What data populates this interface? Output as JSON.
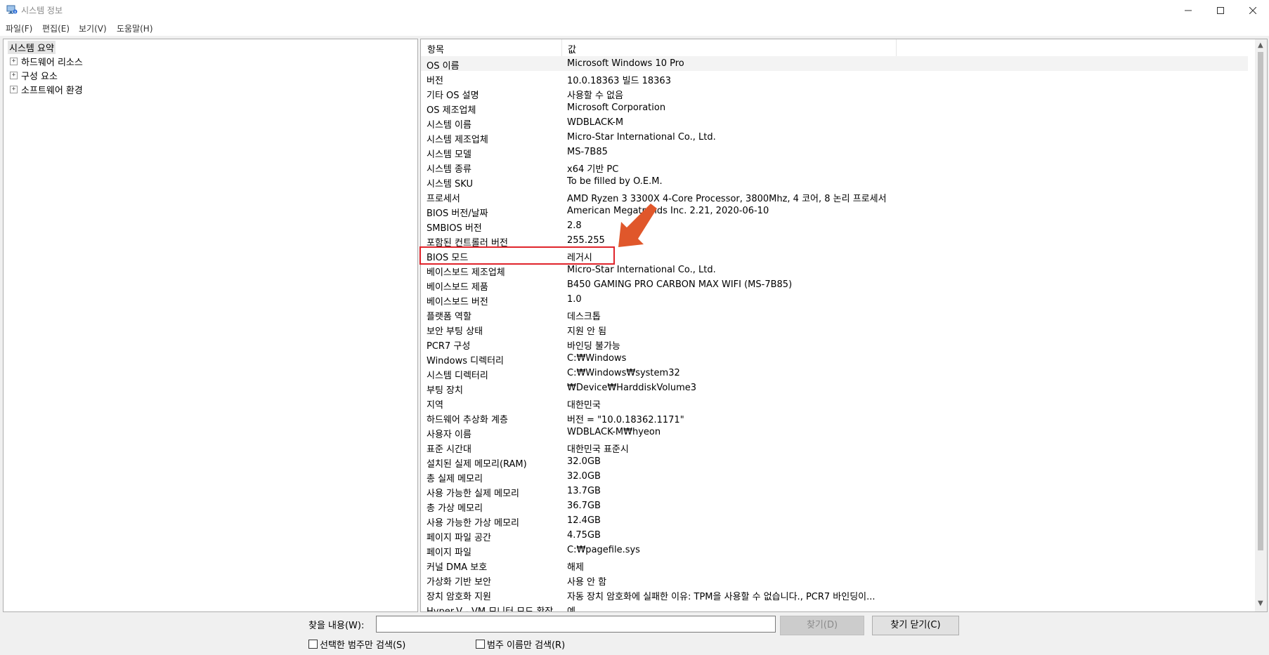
{
  "window": {
    "title": "시스템 정보"
  },
  "menu": [
    {
      "label": "파일(F)"
    },
    {
      "label": "편집(E)"
    },
    {
      "label": "보기(V)"
    },
    {
      "label": "도움말(H)"
    }
  ],
  "tree": {
    "root": "시스템 요약",
    "children": [
      {
        "label": "하드웨어 리소스"
      },
      {
        "label": "구성 요소"
      },
      {
        "label": "소프트웨어 환경"
      }
    ]
  },
  "table": {
    "columns": [
      "항목",
      "값"
    ],
    "rows": [
      {
        "k": "OS 이름",
        "v": "Microsoft Windows 10 Pro"
      },
      {
        "k": "버전",
        "v": "10.0.18363 빌드 18363"
      },
      {
        "k": "기타 OS 설명",
        "v": "사용할 수 없음"
      },
      {
        "k": "OS 제조업체",
        "v": "Microsoft Corporation"
      },
      {
        "k": "시스템 이름",
        "v": "WDBLACK-M"
      },
      {
        "k": "시스템 제조업체",
        "v": "Micro-Star International Co., Ltd."
      },
      {
        "k": "시스템 모델",
        "v": "MS-7B85"
      },
      {
        "k": "시스템 종류",
        "v": "x64 기반 PC"
      },
      {
        "k": "시스템 SKU",
        "v": "To be filled by O.E.M."
      },
      {
        "k": "프로세서",
        "v": "AMD Ryzen 3 3300X 4-Core Processor, 3800Mhz, 4 코어, 8 논리 프로세서"
      },
      {
        "k": "BIOS 버전/날짜",
        "v": "American Megatrends Inc. 2.21, 2020-06-10"
      },
      {
        "k": "SMBIOS 버전",
        "v": "2.8"
      },
      {
        "k": "포함된 컨트롤러 버전",
        "v": "255.255"
      },
      {
        "k": "BIOS 모드",
        "v": "레거시"
      },
      {
        "k": "베이스보드 제조업체",
        "v": "Micro-Star International Co., Ltd."
      },
      {
        "k": "베이스보드 제품",
        "v": "B450 GAMING PRO CARBON MAX WIFI (MS-7B85)"
      },
      {
        "k": "베이스보드 버전",
        "v": "1.0"
      },
      {
        "k": "플랫폼 역할",
        "v": "데스크톱"
      },
      {
        "k": "보안 부팅 상태",
        "v": "지원 안 됨"
      },
      {
        "k": "PCR7 구성",
        "v": "바인딩 불가능"
      },
      {
        "k": "Windows 디렉터리",
        "v": "C:₩Windows"
      },
      {
        "k": "시스템 디렉터리",
        "v": "C:₩Windows₩system32"
      },
      {
        "k": "부팅 장치",
        "v": "₩Device₩HarddiskVolume3"
      },
      {
        "k": "지역",
        "v": "대한민국"
      },
      {
        "k": "하드웨어 추상화 계층",
        "v": "버전 = \"10.0.18362.1171\""
      },
      {
        "k": "사용자 이름",
        "v": "WDBLACK-M₩hyeon"
      },
      {
        "k": "표준 시간대",
        "v": "대한민국 표준시"
      },
      {
        "k": "설치된 실제 메모리(RAM)",
        "v": "32.0GB"
      },
      {
        "k": "총 실제 메모리",
        "v": "32.0GB"
      },
      {
        "k": "사용 가능한 실제 메모리",
        "v": "13.7GB"
      },
      {
        "k": "총 가상 메모리",
        "v": "36.7GB"
      },
      {
        "k": "사용 가능한 가상 메모리",
        "v": "12.4GB"
      },
      {
        "k": "페이지 파일 공간",
        "v": "4.75GB"
      },
      {
        "k": "페이지 파일",
        "v": "C:₩pagefile.sys"
      },
      {
        "k": "커널 DMA 보호",
        "v": "해제"
      },
      {
        "k": "가상화 기반 보안",
        "v": "사용 안 함"
      },
      {
        "k": "장치 암호화 지원",
        "v": "자동 장치 암호화에 실패한 이유: TPM을 사용할 수 없습니다., PCR7 바인딩이..."
      },
      {
        "k": "Hyper-V - VM 모니터 모드 확장",
        "v": "예"
      }
    ]
  },
  "find": {
    "label": "찾을 내용(W):",
    "value": "",
    "find_button": "찾기(D)",
    "close_button": "찾기 닫기(C)",
    "scope_selected": "선택한 범주만 검색(S)",
    "scope_names": "범주 이름만 검색(R)"
  },
  "colors": {
    "highlight": "#e0242b",
    "pointer": "#e0572b"
  }
}
